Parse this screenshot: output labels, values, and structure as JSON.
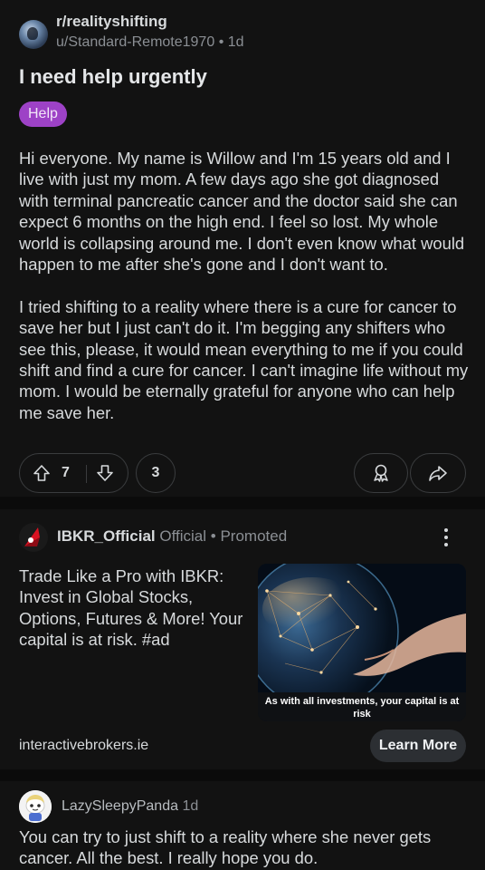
{
  "post": {
    "subreddit": "r/realityshifting",
    "author": "u/Standard-Remote1970",
    "separator": "•",
    "age": "1d",
    "title": "I need help urgently",
    "flair": "Help",
    "body": [
      "Hi everyone. My name is Willow and I'm 15 years old and I live with just my mom. A few days ago she got diagnosed with terminal pancreatic cancer and the doctor said she can expect 6 months on the high end. I feel so lost. My whole world is collapsing around me. I don't even know what would happen to me after she's gone and I don't want to.",
      "I tried shifting to a reality where there is a cure for cancer to save her but I just can't do it. I'm begging any shifters who see this, please, it would mean everything to me if you could shift and find a cure for cancer. I can't imagine life without my mom. I would be eternally grateful for anyone who can help me save her."
    ],
    "upvotes": "7",
    "comments": "3",
    "icons": {
      "up": "upvote-icon",
      "down": "downvote-icon",
      "award": "award-icon",
      "share": "share-icon"
    }
  },
  "ad": {
    "advertiser": "IBKR_Official",
    "official": "Official",
    "separator": "•",
    "promoted": "Promoted",
    "text": "Trade Like a Pro with IBKR: Invest in Global Stocks, Options, Futures & More! Your capital is at risk. #ad",
    "image_caption": "As with all investments, your capital is at risk",
    "url": "interactivebrokers.ie",
    "cta": "Learn More",
    "brand_color": "#d81222"
  },
  "comment": {
    "user": "LazySleepyPanda",
    "age": "1d",
    "text": "You can try to just shift to a reality where she never gets cancer. All the best. I really hope you do."
  },
  "colors": {
    "background": "#0b0b0b",
    "card": "#121212",
    "flair": "#9d42c6",
    "text": "#d7dadc",
    "muted": "#8b8f94"
  }
}
